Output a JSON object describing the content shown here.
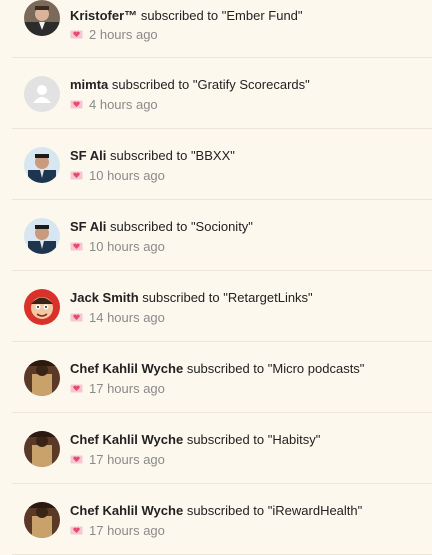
{
  "feed": {
    "items": [
      {
        "name": "Kristofer™",
        "verb": "subscribed to",
        "target": "\"Ember Fund\"",
        "time": "2 hours ago",
        "avatar_icon": "user-photo-icon"
      },
      {
        "name": "mimta",
        "verb": "subscribed to",
        "target": "\"Gratify Scorecards\"",
        "time": "4 hours ago",
        "avatar_icon": "default-avatar-icon"
      },
      {
        "name": "SF Ali",
        "verb": "subscribed to",
        "target": "\"BBXX\"",
        "time": "10 hours ago",
        "avatar_icon": "user-photo-icon"
      },
      {
        "name": "SF Ali",
        "verb": "subscribed to",
        "target": "\"Socionity\"",
        "time": "10 hours ago",
        "avatar_icon": "user-photo-icon"
      },
      {
        "name": "Jack Smith",
        "verb": "subscribed to",
        "target": "\"RetargetLinks\"",
        "time": "14 hours ago",
        "avatar_icon": "cartoon-avatar-icon"
      },
      {
        "name": "Chef Kahlil Wyche",
        "verb": "subscribed to",
        "target": "\"Micro podcasts\"",
        "time": "17 hours ago",
        "avatar_icon": "user-photo-icon"
      },
      {
        "name": "Chef Kahlil Wyche",
        "verb": "subscribed to",
        "target": "\"Habitsy\"",
        "time": "17 hours ago",
        "avatar_icon": "user-photo-icon"
      },
      {
        "name": "Chef Kahlil Wyche",
        "verb": "subscribed to",
        "target": "\"iRewardHealth\"",
        "time": "17 hours ago",
        "avatar_icon": "user-photo-icon"
      }
    ]
  },
  "colors": {
    "background": "#fdf8ee",
    "divider": "#ece6d8",
    "time_text": "#8a8a8a",
    "heart_pink": "#e84a6f"
  }
}
